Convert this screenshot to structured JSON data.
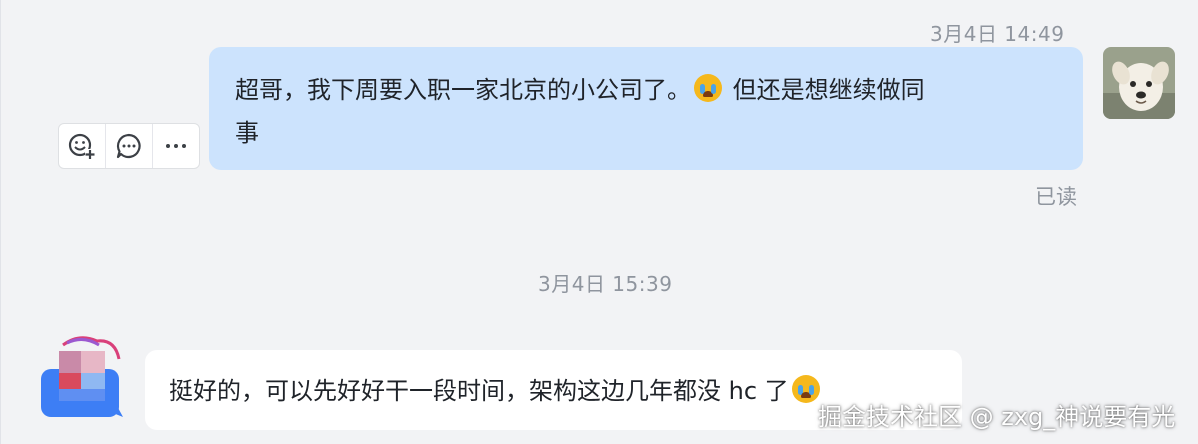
{
  "messages": [
    {
      "timestamp": "3月4日 14:49",
      "text_before_emoji": "超哥，我下周要入职一家北京的小公司了。",
      "emoji": "crying-face",
      "text_after_emoji_line1": " 但还是想继续做同",
      "text_line2": "事",
      "status": "已读"
    },
    {
      "timestamp": "3月4日 15:39",
      "text_before_emoji": "挺好的，可以先好好干一段时间，架构这边几年都没 hc 了",
      "emoji": "crying-face"
    }
  ],
  "toolbar": {
    "icons": [
      "add-reaction-icon",
      "reply-icon",
      "more-icon"
    ]
  },
  "watermark": "掘金技术社区 @ zxg_神说要有光",
  "colors": {
    "background": "#f2f3f5",
    "outgoing_bubble": "#cce3fd",
    "incoming_bubble": "#ffffff",
    "meta_text": "#8f959e"
  }
}
